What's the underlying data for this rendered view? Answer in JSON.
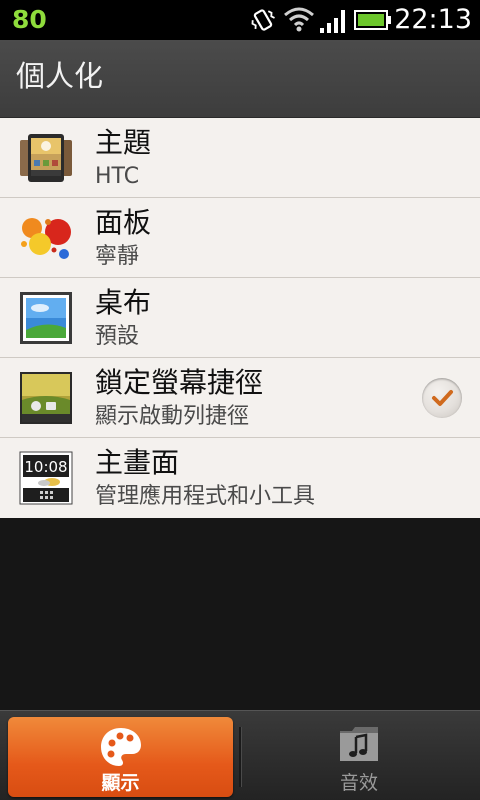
{
  "status_bar": {
    "battery_percent": "80",
    "clock": "22:13",
    "icons": [
      "vibrate-icon",
      "wifi-icon",
      "signal-icon",
      "battery-icon"
    ],
    "battery_color": "#8fdc3c"
  },
  "header": {
    "title": "個人化"
  },
  "list": {
    "items": [
      {
        "title": "主題",
        "subtitle": "HTC",
        "icon": "theme-icon"
      },
      {
        "title": "面板",
        "subtitle": "寧靜",
        "icon": "skin-icon"
      },
      {
        "title": "桌布",
        "subtitle": "預設",
        "icon": "wallpaper-icon"
      },
      {
        "title": "鎖定螢幕捷徑",
        "subtitle": "顯示啟動列捷徑",
        "icon": "lockscreen-icon",
        "checked": true
      },
      {
        "title": "主畫面",
        "subtitle": "管理應用程式和小工具",
        "icon": "home-screen-icon"
      }
    ]
  },
  "tabs": [
    {
      "label": "顯示",
      "icon": "palette-icon",
      "active": true
    },
    {
      "label": "音效",
      "icon": "music-icon",
      "active": false
    }
  ],
  "colors": {
    "accent": "#e5591a",
    "list_background": "#f4f1ee",
    "check_mark": "#d06a1e"
  }
}
